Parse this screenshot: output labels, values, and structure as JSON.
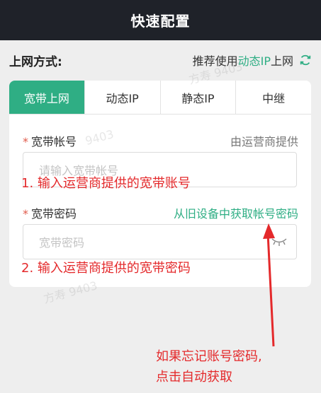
{
  "header": {
    "title": "快速配置"
  },
  "mode": {
    "label": "上网方式:",
    "rec_prefix": "推荐使用",
    "rec_highlight": "动态IP",
    "rec_suffix": "上网"
  },
  "tabs": [
    {
      "label": "宽带上网",
      "active": true
    },
    {
      "label": "动态IP",
      "active": false
    },
    {
      "label": "静态IP",
      "active": false
    },
    {
      "label": "中继",
      "active": false
    }
  ],
  "account": {
    "label": "宽带帐号",
    "hint": "由运营商提供",
    "placeholder": "请输入宽带帐号"
  },
  "password": {
    "label": "宽带密码",
    "link": "从旧设备中获取帐号密码",
    "placeholder": "宽带密码"
  },
  "annotations": {
    "step1": "1. 输入运营商提供的宽带账号",
    "step2": "2. 输入运营商提供的宽带密码",
    "tip_line1": "如果忘记账号密码,",
    "tip_line2": "点击自动获取"
  },
  "colors": {
    "accent": "#2fae84",
    "annotation": "#e4292b",
    "titlebar": "#1f2229"
  }
}
